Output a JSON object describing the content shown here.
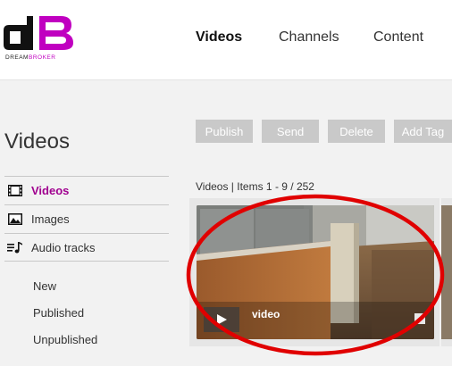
{
  "logo": {
    "dream": "DREAM",
    "broker": "BROKER"
  },
  "nav": {
    "videos": "Videos",
    "channels": "Channels",
    "content": "Content"
  },
  "sidebar": {
    "title": "Videos",
    "items": [
      {
        "label": "Videos",
        "icon": "film-icon"
      },
      {
        "label": "Images",
        "icon": "image-icon"
      },
      {
        "label": "Audio tracks",
        "icon": "audio-list-icon"
      }
    ],
    "sub_items": [
      "New",
      "Published",
      "Unpublished"
    ]
  },
  "toolbar": {
    "publish": "Publish",
    "send": "Send",
    "delete": "Delete",
    "add_tag": "Add Tag"
  },
  "items_info": "Videos | Items 1 - 9 / 252",
  "cards": [
    {
      "title": "video"
    }
  ],
  "colors": {
    "accent": "#a0008f",
    "logo_magenta": "#c000c0",
    "highlight": "#e00000",
    "button": "#c9c9c9"
  }
}
